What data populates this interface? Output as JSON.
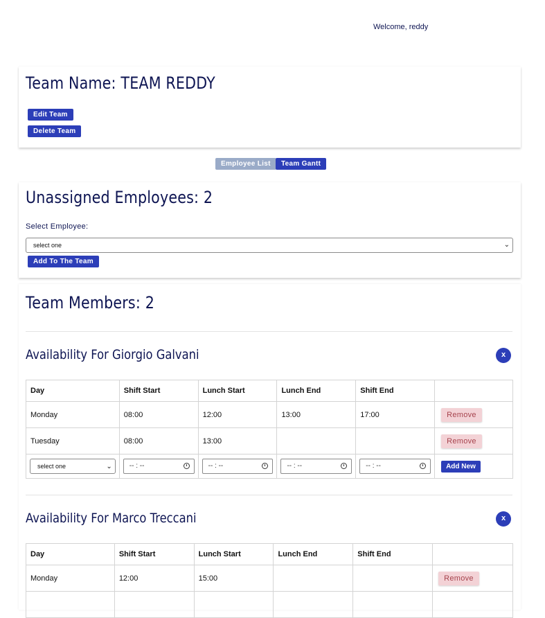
{
  "header": {
    "welcome": "Welcome, reddy"
  },
  "team": {
    "title": "Team Name: TEAM REDDY",
    "edit_label": "Edit Team",
    "delete_label": "Delete Team"
  },
  "view_toggle": {
    "employee_list": "Employee List",
    "team_gantt": "Team Gantt"
  },
  "unassigned": {
    "title": "Unassigned Employees: 2",
    "select_label": "Select Employee:",
    "select_value": "select one",
    "add_label": "Add To The Team"
  },
  "members": {
    "title": "Team Members: 2",
    "columns": [
      "Day",
      "Shift Start",
      "Lunch Start",
      "Lunch End",
      "Shift End",
      ""
    ],
    "close_label": "x",
    "remove_label": "Remove",
    "add_new_label": "Add New",
    "new_row": {
      "day_value": "select one",
      "time_placeholder": "-- : --"
    },
    "people": [
      {
        "heading": "Availability For Giorgio Galvani",
        "rows": [
          {
            "day": "Monday",
            "shift_start": "08:00",
            "lunch_start": "12:00",
            "lunch_end": "13:00",
            "shift_end": "17:00"
          },
          {
            "day": "Tuesday",
            "shift_start": "08:00",
            "lunch_start": "13:00",
            "lunch_end": "",
            "shift_end": ""
          }
        ]
      },
      {
        "heading": "Availability For Marco Treccani",
        "rows": [
          {
            "day": "Monday",
            "shift_start": "12:00",
            "lunch_start": "15:00",
            "lunch_end": "",
            "shift_end": ""
          }
        ]
      }
    ]
  },
  "colors": {
    "primary": "#2c3eb8",
    "heading_text": "#0d1452",
    "remove_bg": "#f3d2d6",
    "remove_text": "#a6434d",
    "toggle_inactive": "#9aabc8"
  }
}
